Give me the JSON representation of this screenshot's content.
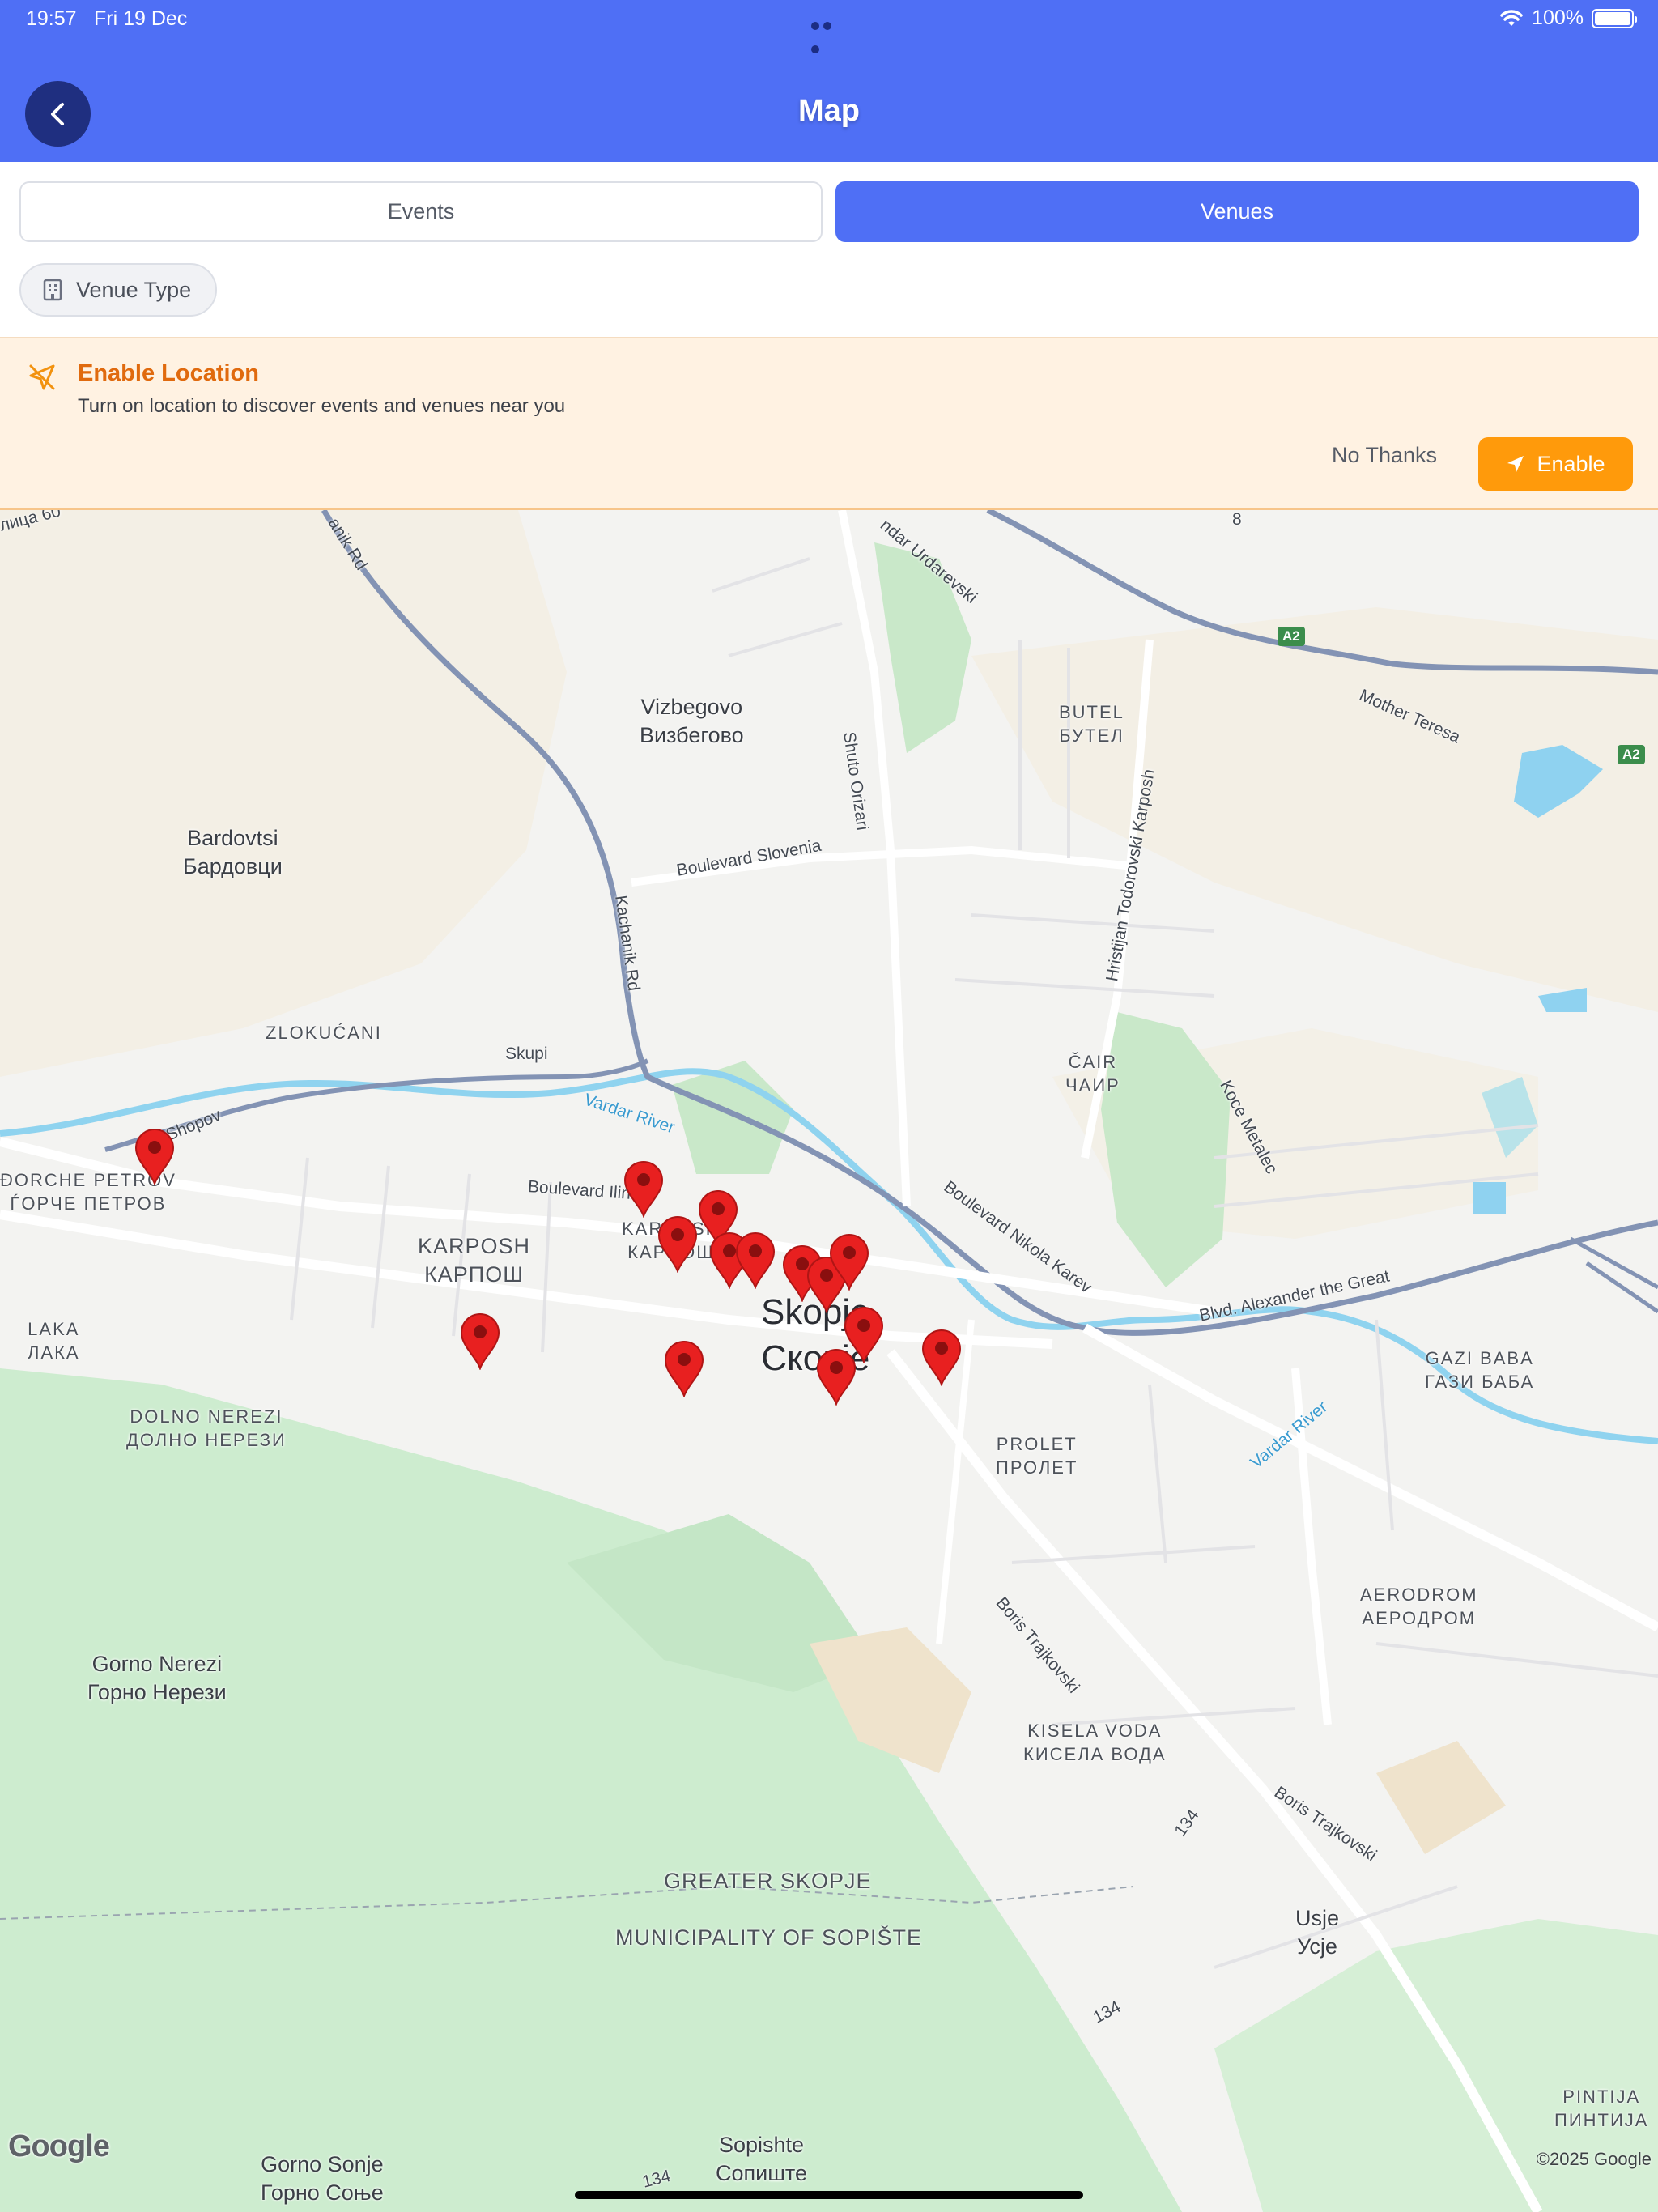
{
  "status_bar": {
    "time": "19:57",
    "date": "Fri 19 Dec",
    "battery": "100%"
  },
  "header": {
    "title": "Map"
  },
  "tabs": [
    {
      "label": "Events",
      "selected": false
    },
    {
      "label": "Venues",
      "selected": true
    }
  ],
  "filter": {
    "label": "Venue Type",
    "icon": "building-icon"
  },
  "location_banner": {
    "title": "Enable Location",
    "message": "Turn on location to discover events and venues near you",
    "dismiss_label": "No Thanks",
    "enable_label": "Enable",
    "icon": "location-off-icon"
  },
  "colors": {
    "header": "#4f6ff5",
    "accent": "#4f6ff5",
    "banner_bg": "#fff2e2",
    "banner_title": "#e06a0e",
    "enable_button": "#ff9a0b",
    "pin": "#e82020"
  },
  "map": {
    "places": {
      "vizbegovo": "Vizbegovo",
      "vizbegovo_local": "Визбегово",
      "butel": "BUTEL",
      "butel_local": "БУТЕЛ",
      "bardovtsi": "Bardovtsi",
      "bardovtsi_local": "Бардовци",
      "zlokukani": "ZLOKUĆANI",
      "cair": "ČAIR",
      "cair_local": "ЧАИР",
      "djorche_petrov": "ĐORCHE PETROV",
      "djorche_petrov_local": "ЃОРЧЕ ПЕТРОВ",
      "karposh": "KARPOSH",
      "karposh_local": "КАРПОШ",
      "karposh_small": "KARPOSH",
      "karposh_small_local": "КАРПОШ",
      "skopje": "Skopje",
      "skopje_local": "Скопје",
      "laka": "LAKA",
      "laka_local": "ЛАКА",
      "dolno_nerezi": "DOLNO NEREZI",
      "dolno_nerezi_local": "ДОЛНО НЕРЕЗИ",
      "gazi_baba": "GAZI BABA",
      "gazi_baba_local": "ГАЗИ БАБА",
      "prolet": "PROLET",
      "prolet_local": "ПРОЛЕТ",
      "aerodrom": "AERODROM",
      "aerodrom_local": "АЕРОДРОМ",
      "gorno_nerezi": "Gorno Nerezi",
      "gorno_nerezi_local": "Горно Нерези",
      "kisela_voda": "KISELA VODA",
      "kisela_voda_local": "КИСЕЛА ВОДА",
      "greater_skopje": "GREATER SKOPJE",
      "sopiste_municipality": "MUNICIPALITY OF SOPIŠTE",
      "usje": "Usje",
      "usje_local": "Усје",
      "pintija": "PINTIJA",
      "pintija_local": "ПИНТИЈА",
      "sopishte": "Sopishte",
      "sopishte_local": "Сопиште",
      "gorno_sonje": "Gorno Sonje",
      "gorno_sonje_local": "Горно Соње"
    },
    "roads": {
      "ulica60": "лица 60",
      "kachanik_top": "anik Rd",
      "kachanik": "Kachanik Rd",
      "urdarevski": "ndar Urdarevski",
      "shuto_orizari": "Shuto Orizari",
      "boulevard_slovenia": "Boulevard Slovenia",
      "hristijan": "Hristijan Todorovski Karposh",
      "mother_teresa": "Mother Teresa",
      "skupi": "Skupi",
      "vardar_river": "Vardar River",
      "vardar_river_2": "Vardar River",
      "shopov": "o Shopov",
      "boulevard_ilinden": "Boulevard Ilin",
      "boulevard_nikola_karev": "Boulevard Nikola Karev",
      "koce_metalec": "Koce Metalec",
      "alexander_the_great": "Blvd. Alexander the Great",
      "boris_trajkovski": "Boris Trajkovski",
      "boris_trajkovski_2": "Boris Trajkovski",
      "route_134_a": "134",
      "route_134_b": "134",
      "route_134_c": "134",
      "a2_1": "A2",
      "a2_2": "A2",
      "road_8": "8"
    },
    "venue_pins": 14,
    "provider": "Google",
    "copyright": "©2025 Google"
  }
}
